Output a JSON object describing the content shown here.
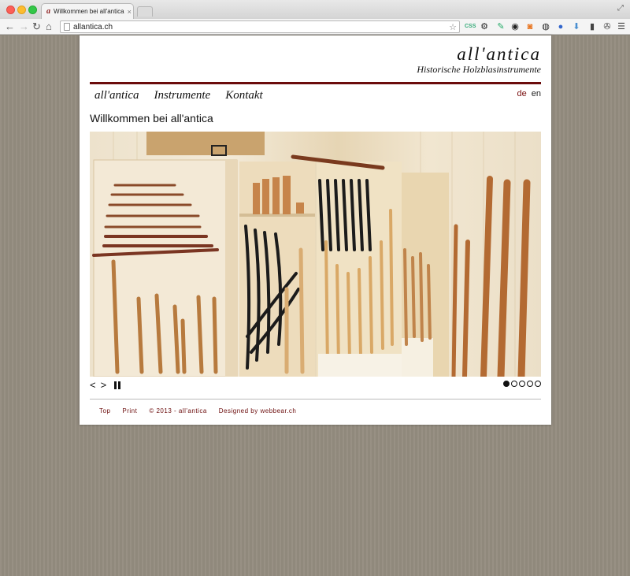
{
  "browser": {
    "tab_title": "Willkommen bei all'antica",
    "tab_favicon": "a",
    "tab_close": "×",
    "url": "allantica.ch",
    "nav": {
      "back": "←",
      "forward": "→",
      "reload": "↻",
      "home": "⌂"
    },
    "star": "☆",
    "extensions": [
      "css-icon",
      "gear-icon",
      "eyedropper-icon",
      "record-icon",
      "rss-icon",
      "reload-icon",
      "globe-icon",
      "download-icon",
      "clipboard-icon",
      "wrench-icon",
      "menu-icon"
    ]
  },
  "site": {
    "logo": "all'antica",
    "tagline": "Historische Holzblasinstrumente",
    "nav": [
      {
        "label": "all'antica"
      },
      {
        "label": "Instrumente"
      },
      {
        "label": "Kontakt"
      }
    ],
    "languages": [
      {
        "code": "de",
        "active": true
      },
      {
        "code": "en",
        "active": false
      }
    ],
    "heading": "Willkommen bei all'antica",
    "slideshow": {
      "prev": "<",
      "next": ">",
      "slide_count": 5,
      "active_slide": 1
    },
    "footer": {
      "top": "Top",
      "print": "Print",
      "copyright": "© 2013 - all'antica",
      "designed": "Designed by webbear.ch"
    }
  },
  "colors": {
    "accent": "#6b0c0c",
    "background": "#958d80"
  }
}
